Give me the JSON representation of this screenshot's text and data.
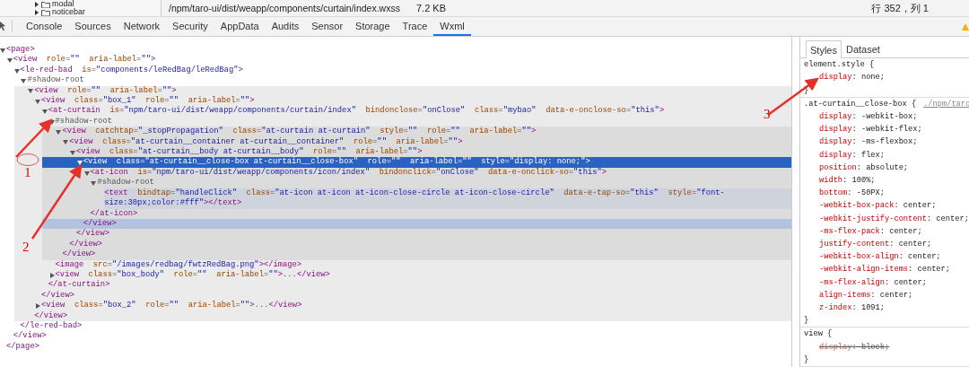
{
  "file_strip": {
    "tree_items": [
      {
        "label": "modal",
        "expanded": false
      },
      {
        "label": "noticebar",
        "expanded": false
      }
    ],
    "path": "/npm/taro-ui/dist/weapp/components/curtain/index.wxss",
    "size": "7.2 KB",
    "cursor_position": "行 352，列 1"
  },
  "tabs": [
    {
      "label": "Console",
      "selected": false
    },
    {
      "label": "Sources",
      "selected": false
    },
    {
      "label": "Network",
      "selected": false
    },
    {
      "label": "Security",
      "selected": false
    },
    {
      "label": "AppData",
      "selected": false
    },
    {
      "label": "Audits",
      "selected": false
    },
    {
      "label": "Sensor",
      "selected": false
    },
    {
      "label": "Storage",
      "selected": false
    },
    {
      "label": "Trace",
      "selected": false
    },
    {
      "label": "Wxml",
      "selected": true
    }
  ],
  "wxml_tree": [
    {
      "open": "<page>",
      "expanded": true,
      "selected": false,
      "close": "</page>",
      "children": [
        {
          "open": "<view  role=\"\"  aria-label=\"\">",
          "expanded": true,
          "selected": false,
          "close": "</view>",
          "children": [
            {
              "open": "<le-red-bad  is=\"components/leRedBag/leRedBag\">",
              "expanded": true,
              "selected": false,
              "close": "</le-red-bad>",
              "children": [
                {
                  "open": "#shadow-root",
                  "expanded": true,
                  "selected": false,
                  "children": [
                    {
                      "open": "<view  role=\"\"  aria-label=\"\">",
                      "expanded": true,
                      "selected": false,
                      "shaded": true,
                      "close": "</view>",
                      "children": [
                        {
                          "open": "<view  class=\"box_1\"  role=\"\"  aria-label=\"\">",
                          "expanded": true,
                          "selected": false,
                          "close": "</view>",
                          "children": [
                            {
                              "open": "<at-curtain  is=\"npm/taro-ui/dist/weapp/components/curtain/index\"  bindonclose=\"onClose\"  class=\"mybao\"  data-e-onclose-so=\"this\">",
                              "expanded": true,
                              "selected": false,
                              "close": "</at-curtain>",
                              "children": [
                                {
                                  "open": "#shadow-root",
                                  "expanded": true,
                                  "selected": false,
                                  "children": [
                                    {
                                      "open": "<view  catchtap=\"_stopPropagation\"  class=\"at-curtain at-curtain\"  style=\"\"  role=\"\"  aria-label=\"\">",
                                      "expanded": true,
                                      "selected": false,
                                      "shaded": true,
                                      "close": "</view>",
                                      "children": [
                                        {
                                          "open": "<view  class=\"at-curtain__container at-curtain__container\"  role=\"\"  aria-label=\"\">",
                                          "expanded": true,
                                          "selected": false,
                                          "close": "</view>",
                                          "children": [
                                            {
                                              "open": "<view  class=\"at-curtain__body at-curtain__body\"  role=\"\"  aria-label=\"\">",
                                              "expanded": true,
                                              "selected": false,
                                              "close": "</view>",
                                              "children": [
                                                {
                                                  "open": "<view  class=\"at-curtain__close-box at-curtain__close-box\"  role=\"\"  aria-label=\"\"  style=\"display: none;\">",
                                                  "expanded": true,
                                                  "selected": true,
                                                  "close": "</view>",
                                                  "children": [
                                                    {
                                                      "open": "<at-icon  is=\"npm/taro-ui/dist/weapp/components/icon/index\"  bindonclick=\"onClose\"  data-e-onclick-so=\"this\">",
                                                      "expanded": true,
                                                      "selected": false,
                                                      "close": "</at-icon>",
                                                      "children": [
                                                        {
                                                          "open": "#shadow-root",
                                                          "expanded": true,
                                                          "selected": false,
                                                          "children": [
                                                            {
                                                              "open": "<text  bindtap=\"handleClick\"  class=\"at-icon at-icon at-icon-close-circle at-icon-close-circle\"  data-e-tap-so=\"this\"  style=\"font-size:30px;color:#fff\"></text>",
                                                              "selected": false,
                                                              "hovered": true
                                                            }
                                                          ]
                                                        }
                                                      ]
                                                    }
                                                  ]
                                                }
                                              ]
                                            }
                                          ]
                                        }
                                      ]
                                    }
                                  ]
                                },
                                {
                                  "open": "<image  src=\"/images/redbag/fwtzRedBag.png\"></image>",
                                  "selected": false
                                },
                                {
                                  "open": "<view  class=\"box_body\"  role=\"\"  aria-label=\"\">...</view>",
                                  "expanded": false,
                                  "selected": false
                                }
                              ]
                            }
                          ]
                        },
                        {
                          "open": "<view  class=\"box_2\"  role=\"\"  aria-label=\"\">...</view>",
                          "expanded": false,
                          "selected": false
                        }
                      ]
                    }
                  ]
                }
              ]
            }
          ]
        }
      ]
    }
  ],
  "styles_panel": {
    "tabs": [
      {
        "label": "Styles",
        "selected": true
      },
      {
        "label": "Dataset",
        "selected": false
      }
    ],
    "rules": [
      {
        "selector": "element.style {",
        "props": [
          {
            "text": "display: none;",
            "overridden": false
          }
        ],
        "close": "}"
      },
      {
        "selector": ".at-curtain__close-box {",
        "source": "./npm/taro",
        "props": [
          {
            "text": "display: -webkit-box;",
            "overridden": false
          },
          {
            "text": "display: -webkit-flex;",
            "overridden": false
          },
          {
            "text": "display: -ms-flexbox;",
            "overridden": false
          },
          {
            "text": "display: flex;",
            "overridden": false
          },
          {
            "text": "position: absolute;",
            "overridden": false
          },
          {
            "text": "width: 100%;",
            "overridden": false
          },
          {
            "text": "bottom: -50PX;",
            "overridden": false
          },
          {
            "text": "-webkit-box-pack: center;",
            "overridden": false
          },
          {
            "text": "-webkit-justify-content: center;",
            "overridden": false
          },
          {
            "text": "-ms-flex-pack: center;",
            "overridden": false
          },
          {
            "text": "justify-content: center;",
            "overridden": false
          },
          {
            "text": "-webkit-box-align: center;",
            "overridden": false
          },
          {
            "text": "-webkit-align-items: center;",
            "overridden": false
          },
          {
            "text": "-ms-flex-align: center;",
            "overridden": false
          },
          {
            "text": "align-items: center;",
            "overridden": false
          },
          {
            "text": "z-index: 1091;",
            "overridden": false
          }
        ],
        "close": "}"
      },
      {
        "selector": "view {",
        "props": [
          {
            "text": "display: block;",
            "overridden": true
          }
        ],
        "close": "}"
      }
    ]
  },
  "annotations": [
    {
      "label": "1"
    },
    {
      "label": "2"
    },
    {
      "label": "3"
    }
  ]
}
